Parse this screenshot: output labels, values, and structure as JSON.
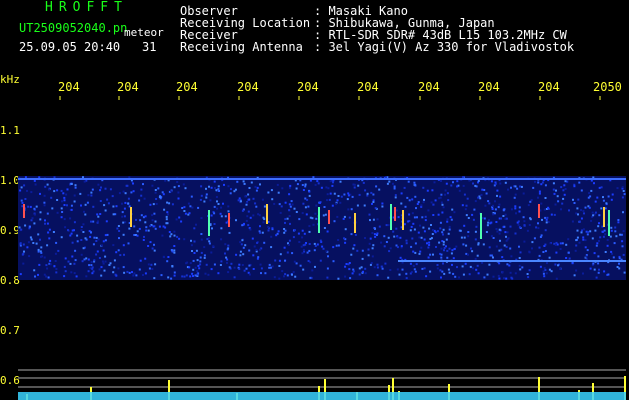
{
  "header": {
    "title": "HROFFT",
    "filename": "UT2509052040.pn",
    "detect_label": "meteor",
    "datetime": "25.09.05 20:40",
    "count": "31"
  },
  "station": {
    "rows": [
      {
        "label": "Observer",
        "value": ": Masaki Kano"
      },
      {
        "label": "Receiving Location",
        "value": ": Shibukawa, Gunma, Japan"
      },
      {
        "label": "Receiver",
        "value": ": RTL-SDR SDR# 43dB L15 103.2MHz CW"
      },
      {
        "label": "Receiving Antenna",
        "value": ": 3el Yagi(V) Az 330 for Vladivostok"
      }
    ]
  },
  "axis": {
    "y_unit": "kHz",
    "y_ticks": [
      "1.1",
      "1.0",
      "0.9",
      "0.8",
      "0.7",
      "0.6"
    ],
    "x_ticks": [
      "204",
      "204",
      "204",
      "204",
      "204",
      "204",
      "204",
      "204",
      "204",
      "2050"
    ]
  },
  "colors": {
    "header_green": "#19ff19",
    "axis_yellow": "#ffff33",
    "signal_blue": "#1a3cff",
    "noise_cyan": "#39d3ff"
  }
}
